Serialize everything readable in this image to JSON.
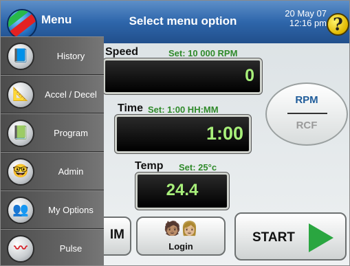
{
  "header": {
    "menu_label": "Menu",
    "title": "Select menu option",
    "date": "20 May 07",
    "time": "12:16 pm",
    "help_symbol": "?",
    "bar_color": "#2e66ab"
  },
  "speed": {
    "label": "Speed",
    "set_text": "Set: 10 000 RPM",
    "value": "0"
  },
  "time": {
    "label": "Time",
    "set_text": "Set:  1:00 HH:MM",
    "value": "1:00"
  },
  "temp": {
    "label": "Temp",
    "set_text": "Set: 25°c",
    "value": "24.4"
  },
  "units_toggle": {
    "active": "RPM",
    "inactive": "RCF"
  },
  "buttons": {
    "partial_label": "IM",
    "login_label": "Login",
    "login_icon": "users-icon",
    "start_label": "START",
    "start_icon": "play-arrow-icon",
    "start_color": "#2aa640"
  },
  "sidebar": {
    "items": [
      {
        "label": "History",
        "icon": "history-icon"
      },
      {
        "label": "Accel / Decel",
        "icon": "accel-decel-icon"
      },
      {
        "label": "Program",
        "icon": "program-icon"
      },
      {
        "label": "Admin",
        "icon": "admin-icon"
      },
      {
        "label": "My Options",
        "icon": "my-options-icon"
      },
      {
        "label": "Pulse",
        "icon": "pulse-icon"
      }
    ]
  },
  "colors": {
    "display_text": "#a8f07a",
    "set_text": "#2f8a2a",
    "accent_blue": "#1f5c9a"
  }
}
